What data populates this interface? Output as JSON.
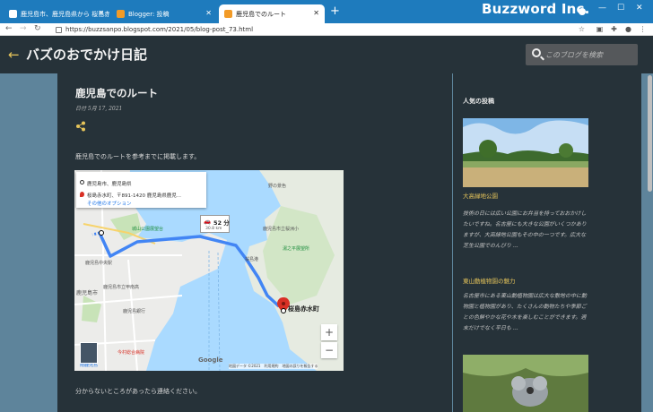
{
  "browser": {
    "tabs": [
      {
        "title": "鹿児島市、鹿児島県から 桜島赤水町..."
      },
      {
        "title": "Blogger: 投稿"
      },
      {
        "title": "鹿児島でのルート",
        "active": true
      }
    ],
    "new_tab": "+",
    "brand": "Buzzword Inc.",
    "url": "https://buzzsanpo.blogspot.com/2021/05/blog-post_73.html"
  },
  "blog": {
    "title": "バズのおでかけ日記",
    "search_placeholder": "このブログを検索"
  },
  "post": {
    "title": "鹿児島でのルート",
    "date": "日付 5月 17, 2021",
    "intro": "鹿児島でのルートを参考までに掲載します。",
    "outro": "分からないところがあったら連絡ください。"
  },
  "map": {
    "origin": "鹿児島市、鹿児島県",
    "destination": "桜島赤水町、〒891-1420 鹿児島県鹿児...",
    "other_options": "その他のオプション",
    "duration": "52 分",
    "distance": "30.8 km",
    "dest_label": "桜島赤水町",
    "labels": {
      "area1": "鹿児島市立桜洲小",
      "area2": "湯之平展望所",
      "area3": "鹿児島中央駅",
      "area4": "鹿児島市立甲南高",
      "area5": "今村総合病院",
      "area6": "鹿児島銀行",
      "area7": "南鹿児島",
      "area8": "鹿児島市",
      "area9": "桜島港",
      "area10": "野の景色",
      "park": "城山公園展望台"
    },
    "footer": "地図データ ©2021　利用規約　地図の誤りを報告する",
    "zoom_in": "+",
    "zoom_out": "−",
    "google": "Google"
  },
  "sidebar": {
    "title": "人気の投稿",
    "posts": [
      {
        "title": "大高緑地公園",
        "snippet": "技術の日には広い公園にお弁当を持っておおかけしたいですね。名古屋にも大きな公園がいくつかありますが、大高緑地公園もその中の一つです。広大な芝生公園でのんびり ..."
      },
      {
        "title": "東山動植物園の魅力",
        "snippet": "名古屋市にある東山動植物園は広大な敷地の中に動物園と植物園があり、たくさんの動物たちや季節ごとの色鮮やかな花や木を楽しむことができます。週末だけでなく平日も ..."
      }
    ]
  },
  "colors": {
    "tabbar": "#1e7bbd",
    "page_bg": "#263239",
    "gap_bg": "#5e849b",
    "accent": "#e6c45a"
  }
}
